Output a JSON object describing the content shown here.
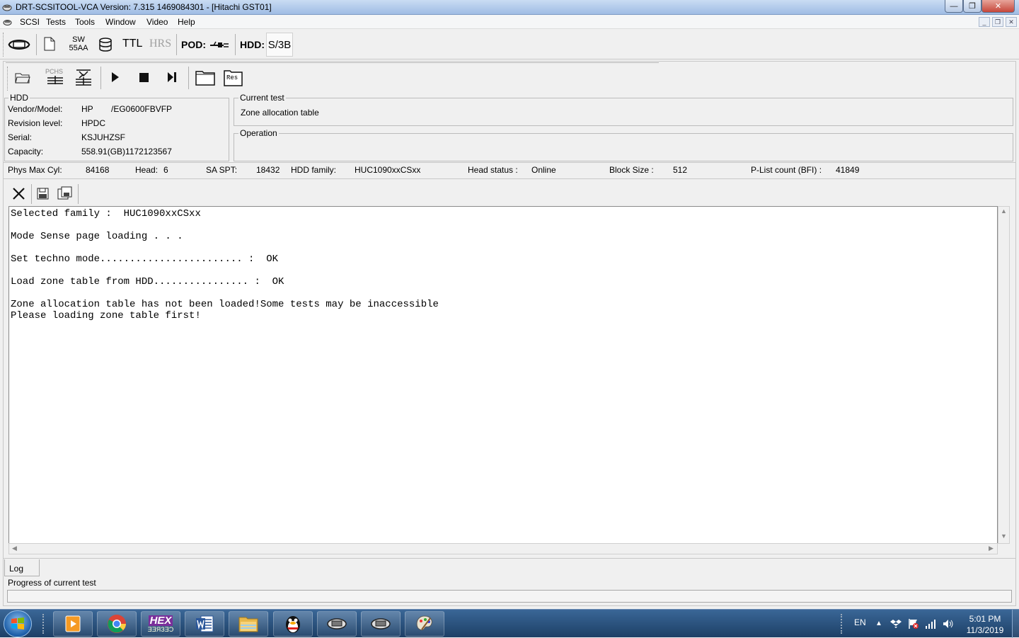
{
  "window": {
    "title": "DRT-SCSITOOL-VCA Version: 7.315  1469084301 - [Hitachi GST01]",
    "min_glyph": "—",
    "max_glyph": "❐",
    "close_glyph": "✕"
  },
  "menu": {
    "items": [
      "SCSI",
      "Tests",
      "Tools",
      "Window",
      "Video",
      "Help"
    ]
  },
  "mdi_controls": {
    "min": "_",
    "restore": "❐",
    "close": "✕"
  },
  "toolbar": {
    "sw_top": "SW",
    "sw_bottom": "55AA",
    "ttl": "TTL",
    "hrs": "HRS",
    "pod_label": "POD:",
    "hdd_label": "HDD:",
    "hdd_value": "S/3B"
  },
  "test_toolbar": {
    "pchs": "PCHS",
    "res": "Res"
  },
  "hdd": {
    "legend": "HDD",
    "vendor_label": "Vendor/Model:",
    "vendor_value": "HP",
    "model_value": "/EG0600FBVFP",
    "revision_label": "Revision level:",
    "revision_value": "HPDC",
    "serial_label": "Serial:",
    "serial_value": "KSJUHZSF",
    "capacity_label": "Capacity:",
    "capacity_value": "558.91(GB)1172123567"
  },
  "current_test": {
    "legend": "Current test",
    "value": "Zone allocation table"
  },
  "operation": {
    "legend": "Operation"
  },
  "status": {
    "phys_max_cyl_label": "Phys Max Cyl:",
    "phys_max_cyl_value": "84168",
    "head_label": "Head:",
    "head_value": "6",
    "sa_spt_label": "SA SPT:",
    "sa_spt_value": "18432",
    "family_label": "HDD family:",
    "family_value": "HUC1090xxCSxx",
    "head_status_label": "Head status :",
    "head_status_value": "Online",
    "block_size_label": "Block Size :",
    "block_size_value": "512",
    "plist_label": "P-List count (BFI) :",
    "plist_value": "41849"
  },
  "log": {
    "lines": [
      "Selected family :  HUC1090xxCSxx",
      "",
      "Mode Sense page loading . . .",
      "",
      "Set techno mode........................ :  OK",
      "",
      "Load zone table from HDD................ :  OK",
      "",
      "Zone allocation table has not been loaded!Some tests may be inaccessible",
      "Please loading zone table first!"
    ]
  },
  "tabs": {
    "log": "Log"
  },
  "progress": {
    "label": "Progress of  current test",
    "value": 0
  },
  "taskbar": {
    "hex_top": "HEX",
    "hex_bottom": "ƎƎЯЗƎƆ",
    "lang": "EN",
    "time": "5:01 PM",
    "date": "11/3/2019"
  },
  "colors": {
    "taskbar": "#2b5283",
    "title_bar": "#b5cdee",
    "close_button": "#c6463a"
  }
}
